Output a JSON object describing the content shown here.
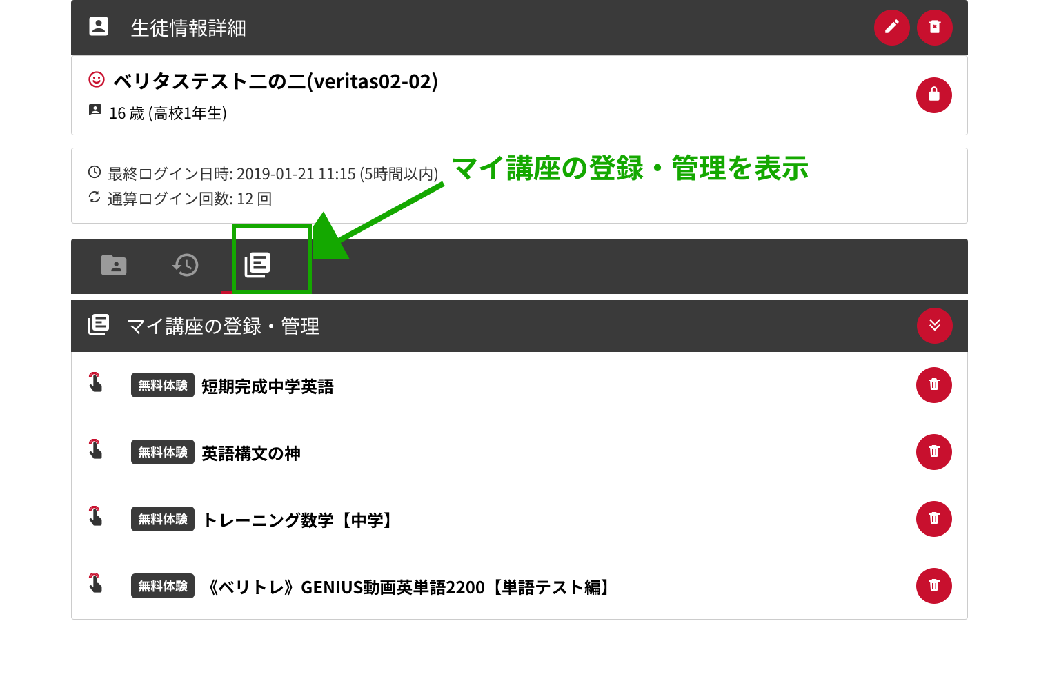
{
  "header": {
    "title": "生徒情報詳細"
  },
  "student": {
    "name": "ベリタステスト二の二(veritas02-02)",
    "age_line": "16 歳 (高校1年生)"
  },
  "login": {
    "last_login": "最終ログイン日時: 2019-01-21 11:15 (5時間以内)",
    "total_count": "通算ログイン回数: 12 回"
  },
  "annotation": {
    "text": "マイ講座の登録・管理を表示"
  },
  "section": {
    "title": "マイ講座の登録・管理"
  },
  "courses": [
    {
      "badge": "無料体験",
      "name": "短期完成中学英語"
    },
    {
      "badge": "無料体験",
      "name": "英語構文の神"
    },
    {
      "badge": "無料体験",
      "name": "トレーニング数学【中学】"
    },
    {
      "badge": "無料体験",
      "name": "《ベリトレ》GENIUS動画英単語2200【単語テスト編】"
    }
  ]
}
